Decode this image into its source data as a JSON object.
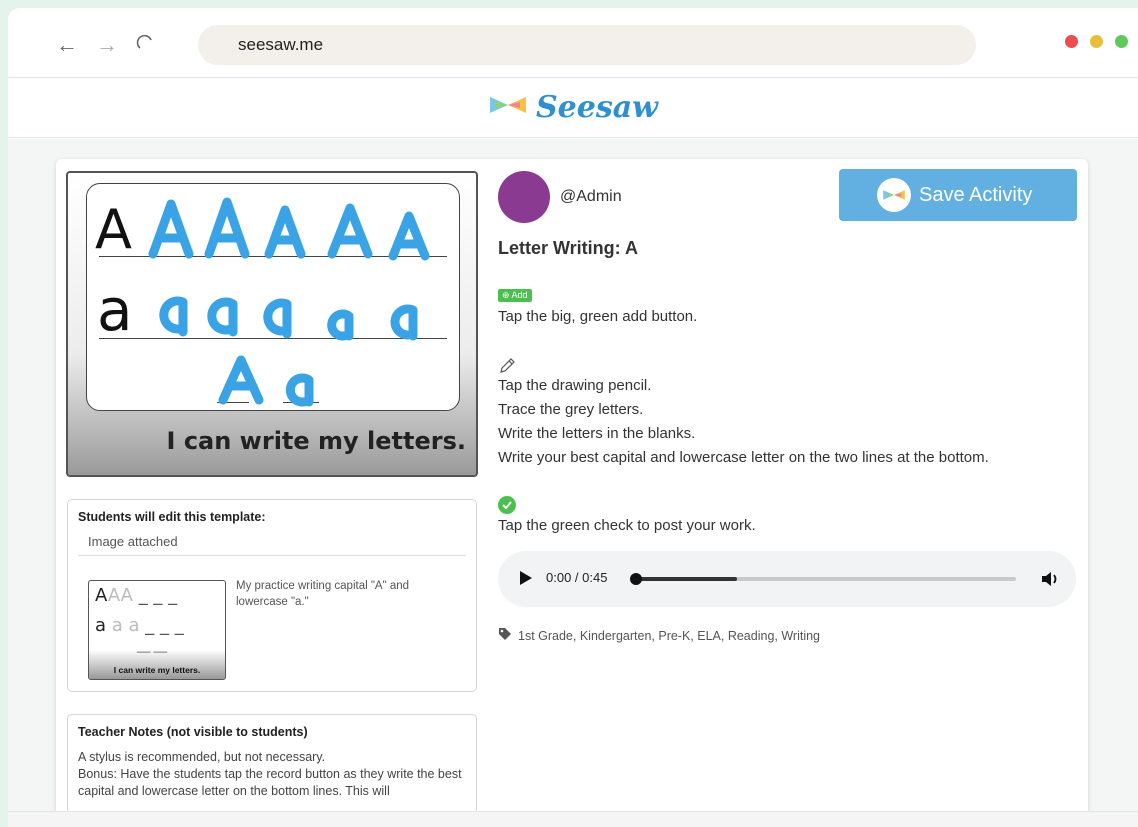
{
  "browser": {
    "url": "seesaw.me",
    "dot_colors": [
      "#ee4d4f",
      "#e8bf3c",
      "#5fca5b"
    ]
  },
  "site": {
    "logo_text": "Seesaw"
  },
  "activity": {
    "username": "@Admin",
    "save_label": "Save Activity",
    "title": "Letter Writing: A",
    "add_badge": "⊕ Add",
    "steps": [
      "Tap the big, green add button.",
      "Tap the drawing pencil.",
      "Trace the grey letters.",
      "Write the letters in the blanks.",
      "Write your best capital and lowercase letter on the two lines at the bottom.",
      "Tap the green check to post your work."
    ],
    "audio": {
      "time": "0:00 / 0:45",
      "progress": 0.27
    },
    "tags": "1st Grade, Kindergarten, Pre-K, ELA, Reading, Writing"
  },
  "preview": {
    "capital_model": "A",
    "lower_model": "a",
    "caption": "I can write my letters."
  },
  "template_panel": {
    "heading": "Students will edit this template:",
    "attached": "Image attached",
    "description": "My practice writing capital \"A\" and lowercase \"a.\"",
    "thumb_caption": "I can write my letters."
  },
  "notes_panel": {
    "heading": "Teacher Notes (not visible to students)",
    "line1": "A stylus is recommended, but not necessary.",
    "line2": "Bonus: Have the students tap the record button as they write the best capital and lowercase letter on the bottom lines. This will"
  },
  "colors": {
    "accent_blue": "#62afe1",
    "trace_blue": "#39a3e6",
    "check_green": "#4cc04e",
    "avatar_purple": "#8b3a91"
  }
}
